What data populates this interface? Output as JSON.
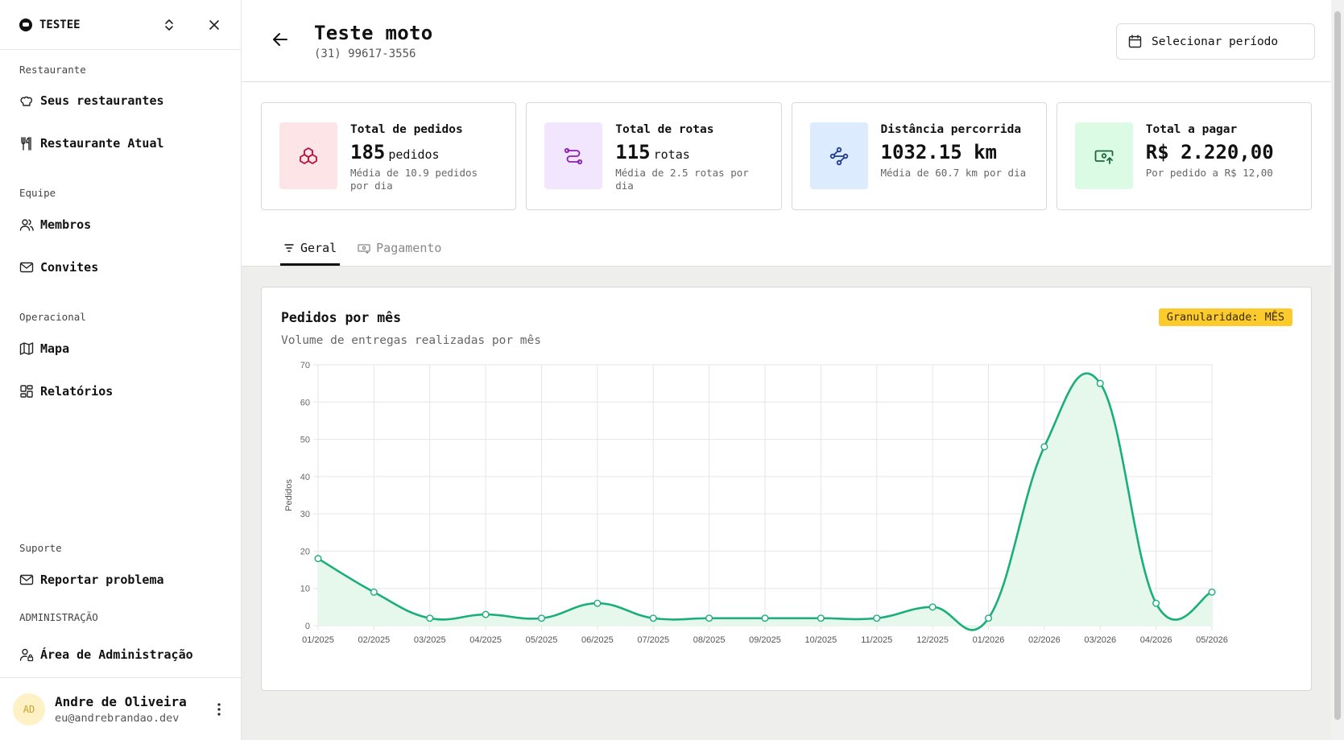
{
  "sidebar": {
    "org_name": "TESTEE",
    "sections": {
      "restaurante": "Restaurante",
      "equipe": "Equipe",
      "operacional": "Operacional",
      "suporte": "Suporte",
      "administracao": "ADMINISTRAÇÃO"
    },
    "items": {
      "seus_restaurantes": "Seus restaurantes",
      "restaurante_atual": "Restaurante Atual",
      "membros": "Membros",
      "convites": "Convites",
      "mapa": "Mapa",
      "relatorios": "Relatórios",
      "reportar": "Reportar problema",
      "admin_area": "Área de Administração"
    },
    "user": {
      "initials": "AD",
      "name": "Andre de Oliveira",
      "email": "eu@andrebrandao.dev"
    }
  },
  "header": {
    "title": "Teste moto",
    "phone": "(31) 99617-3556",
    "period_button": "Selecionar período"
  },
  "stats": [
    {
      "label": "Total de pedidos",
      "value": "185",
      "unit": "pedidos",
      "note": "Média de 10.9 pedidos por dia",
      "color": "#fde4e7",
      "icon_color": "#b4123a"
    },
    {
      "label": "Total de rotas",
      "value": "115",
      "unit": "rotas",
      "note": "Média de 2.5 rotas por dia",
      "color": "#f1e6fe",
      "icon_color": "#8a1fb8"
    },
    {
      "label": "Distância percorrida",
      "value": "1032.15 km",
      "unit": "",
      "note": "Média de 60.7 km por dia",
      "color": "#dcebfe",
      "icon_color": "#1f3a9a"
    },
    {
      "label": "Total a pagar",
      "value": "R$ 2.220,00",
      "unit": "",
      "note": "Por pedido a R$ 12,00",
      "color": "#dcfbe5",
      "icon_color": "#176b3a"
    }
  ],
  "tabs": [
    {
      "label": "Geral",
      "active": true
    },
    {
      "label": "Pagamento",
      "active": false
    }
  ],
  "chart_card": {
    "title": "Pedidos por mês",
    "subtitle": "Volume de entregas realizadas por mês",
    "badge": "Granularidade: MÊS"
  },
  "chart_data": {
    "type": "area",
    "categories": [
      "01/2025",
      "02/2025",
      "03/2025",
      "04/2025",
      "05/2025",
      "06/2025",
      "07/2025",
      "08/2025",
      "09/2025",
      "10/2025",
      "11/2025",
      "12/2025",
      "01/2026",
      "02/2026",
      "03/2026",
      "04/2026",
      "05/2026"
    ],
    "values": [
      18,
      9,
      2,
      3,
      2,
      6,
      2,
      2,
      2,
      2,
      2,
      5,
      2,
      48,
      65,
      6,
      9
    ],
    "ylabel": "Pedidos",
    "ylim": [
      0,
      70
    ],
    "yticks": [
      0,
      10,
      20,
      30,
      40,
      50,
      60,
      70
    ],
    "grid": true,
    "line_color": "#1aae7a",
    "fill_color": "#e6f7ec"
  }
}
